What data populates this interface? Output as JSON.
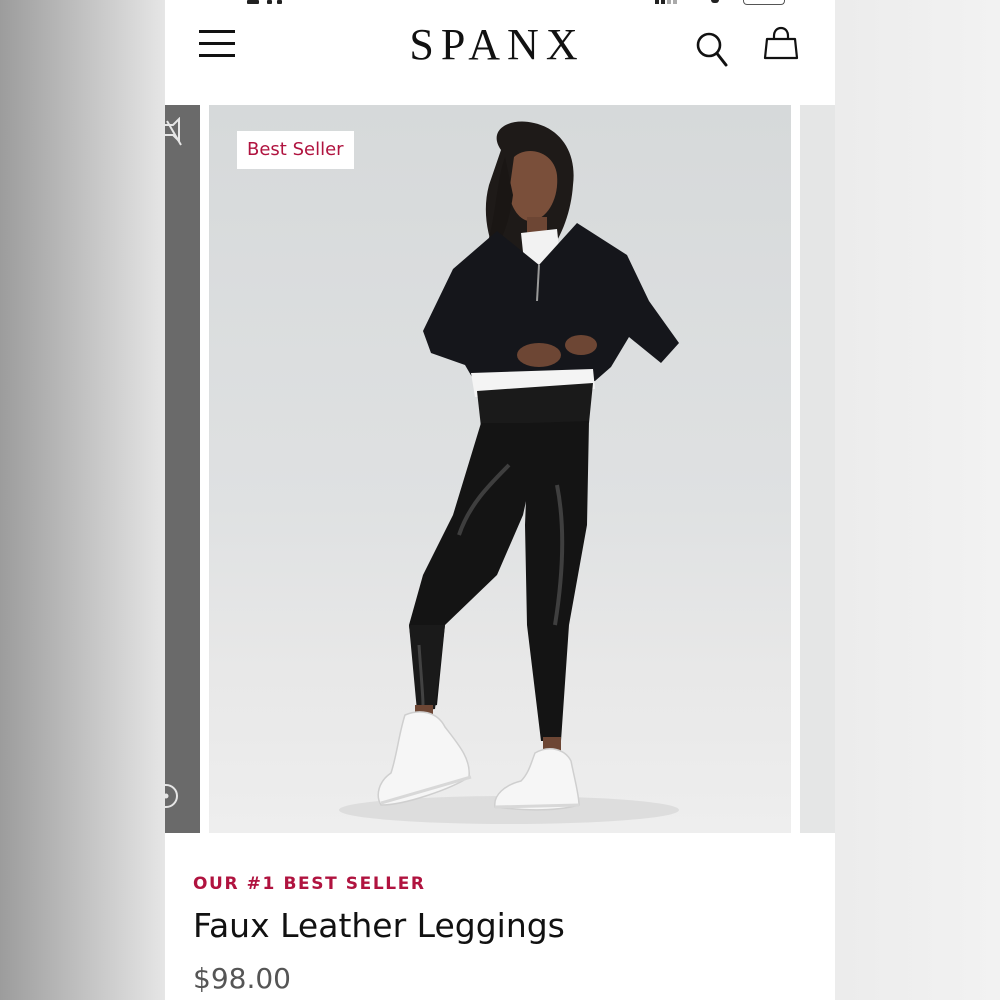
{
  "header": {
    "brand": "SPANX",
    "menu_icon": "hamburger-menu-icon",
    "search_icon": "search-icon",
    "bag_icon": "shopping-bag-icon"
  },
  "carousel": {
    "badge": "Best Seller",
    "image": "model wearing black faux leather leggings, black half-zip pullover and white sneakers",
    "prev_arrow_icon": "speaker-muted-icon",
    "prev_dot_icon": "circle-icon"
  },
  "product": {
    "eyebrow": "OUR #1 BEST SELLER",
    "name": "Faux Leather Leggings",
    "price": "$98.00"
  },
  "colors": {
    "accent": "#b0133f",
    "text": "#111111",
    "price": "#555555",
    "slide_background": "#dcdfe0"
  }
}
